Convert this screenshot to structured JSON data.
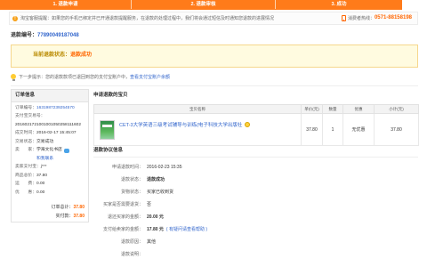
{
  "progress": {
    "steps": [
      "1. 退款申请",
      "2. 退款审核",
      "3. 成功"
    ]
  },
  "notice": {
    "icon": "info-icon",
    "text": "淘宝客服提醒：如果您的手机已绑定并已开通退款提醒服务，在退款的处理过程中，我们将会通过短信及时通知您退款的进展情况",
    "hotline_icon": "phone-icon",
    "hotline_label": "消费者热线：",
    "hotline_number": "0571-88158198"
  },
  "refund": {
    "id_label": "退款编号：",
    "id": "77890049187048"
  },
  "status": {
    "label": "当前退款状态：",
    "value": "退款成功"
  },
  "next_step": {
    "icon": "bulb-icon",
    "label": "下一步提示：",
    "text": "您的退款款项已退回到您的支付宝账户中，",
    "link": "查看支付宝账户余额"
  },
  "order": {
    "title": "订单信息",
    "rows": [
      {
        "label": "订单编号：",
        "value": "1631987239254570"
      },
      {
        "label": "支付宝交易号：",
        "value": "2016021721001001050258111602"
      },
      {
        "label": "成交时间：",
        "value": "2016-02-17 15:45:07"
      },
      {
        "label": "交易状态：",
        "value": "交易成功"
      },
      {
        "label": "卖　　家：",
        "value": "学海文化书店",
        "contact": "和我联系"
      },
      {
        "label": "卖家支付宝：",
        "value": "j***"
      },
      {
        "label": "商品总价：",
        "value": "37.80"
      },
      {
        "label": "运　　费：",
        "value": "0.00"
      },
      {
        "label": "优　　惠：",
        "value": "0.00"
      }
    ],
    "total_label": "订单总计：",
    "total": "37.80",
    "paid_label": "实付款：",
    "paid": "37.80"
  },
  "items": {
    "title": "申请退款的宝贝",
    "columns": [
      "宝贝名称",
      "单价(元)",
      "数量",
      "优惠",
      "小计(元)"
    ],
    "rows": [
      {
        "name": "CET-3大学英语三级考试辅导与训练(电子科技大学出版社",
        "price": "37.80",
        "qty": "1",
        "discount": "无优惠",
        "subtotal": "37.80"
      }
    ]
  },
  "agreement": {
    "title": "退款协议信息",
    "rows": [
      {
        "label": "申请退款时间：",
        "value": "2016-02-23 15:35"
      },
      {
        "label": "退款状态：",
        "value": "退款成功"
      },
      {
        "label": "货物状态：",
        "value": "买家已收到货"
      },
      {
        "label": "买家是否需要退货：",
        "value": "否"
      },
      {
        "label": "退还买家的金额：",
        "value": "20.00 元"
      },
      {
        "label": "支付给卖家的金额：",
        "value": "17.80 元",
        "note": "( 有疑问请查看帮助 )"
      },
      {
        "label": "退款原因：",
        "value": "其他"
      },
      {
        "label": "退款说明：",
        "value": ""
      }
    ]
  },
  "colors": {
    "accent": "#ff6600",
    "link": "#3366cc",
    "bar": "#ff7b1a",
    "notice_bg": "#fffbe0",
    "notice_border": "#f6d78d"
  }
}
